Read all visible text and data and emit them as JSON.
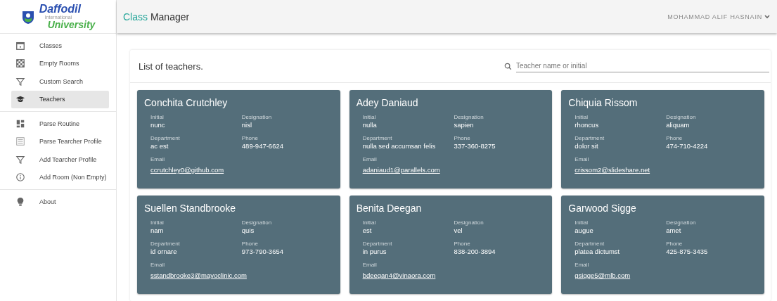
{
  "logo": {
    "name": "Daffodil",
    "subtitle": "International",
    "line2": "University"
  },
  "sidebar": {
    "groups": [
      {
        "items": [
          {
            "label": "Classes",
            "kind": "calendar",
            "selected": false
          },
          {
            "label": "Empty Rooms",
            "kind": "checker",
            "selected": false
          },
          {
            "label": "Custom Search",
            "kind": "filter",
            "selected": false
          },
          {
            "label": "Teachers",
            "kind": "cap",
            "selected": true
          }
        ]
      },
      {
        "items": [
          {
            "label": "Parse Routine",
            "kind": "dashboard",
            "selected": false
          },
          {
            "label": "Parse Tearcher Profile",
            "kind": "list",
            "selected": false
          },
          {
            "label": "Add Tearcher Profile",
            "kind": "filter",
            "selected": false
          },
          {
            "label": "Add Room (Non Empty)",
            "kind": "info",
            "selected": false
          }
        ]
      },
      {
        "items": [
          {
            "label": "About",
            "kind": "bulb",
            "selected": false
          }
        ]
      }
    ]
  },
  "header": {
    "title_accent": "Class",
    "title_rest": "Manager",
    "user": "MOHAMMAD ALIF HASNAIN"
  },
  "panel": {
    "title": "List of teachers.",
    "search": {
      "placeholder": "Teacher name or initial"
    }
  },
  "teachers": [
    {
      "name": "Conchita Crutchley",
      "fields": [
        {
          "label": "Initial",
          "value": "nunc"
        },
        {
          "label": "Designation",
          "value": "nisl"
        },
        {
          "label": "Department",
          "value": "ac est"
        },
        {
          "label": "Phone",
          "value": "489-947-6624"
        }
      ],
      "email_label": "Email",
      "email": "ccrutchley0@github.com"
    },
    {
      "name": "Adey Daniaud",
      "fields": [
        {
          "label": "Initial",
          "value": "nulla"
        },
        {
          "label": "Designation",
          "value": "sapien"
        },
        {
          "label": "Department",
          "value": "nulla sed accumsan felis"
        },
        {
          "label": "Phone",
          "value": "337-360-8275"
        }
      ],
      "email_label": "Email",
      "email": "adaniaud1@parallels.com"
    },
    {
      "name": "Chiquia Rissom",
      "fields": [
        {
          "label": "Initial",
          "value": "rhoncus"
        },
        {
          "label": "Designation",
          "value": "aliquam"
        },
        {
          "label": "Department",
          "value": "dolor sit"
        },
        {
          "label": "Phone",
          "value": "474-710-4224"
        }
      ],
      "email_label": "Email",
      "email": "crissom2@slideshare.net"
    },
    {
      "name": "Suellen Standbrooke",
      "fields": [
        {
          "label": "Initial",
          "value": "nam"
        },
        {
          "label": "Designation",
          "value": "quis"
        },
        {
          "label": "Department",
          "value": "id ornare"
        },
        {
          "label": "Phone",
          "value": "973-790-3654"
        }
      ],
      "email_label": "Email",
      "email": "sstandbrooke3@mayoclinic.com"
    },
    {
      "name": "Benita Deegan",
      "fields": [
        {
          "label": "Initial",
          "value": "est"
        },
        {
          "label": "Designation",
          "value": "vel"
        },
        {
          "label": "Department",
          "value": "in purus"
        },
        {
          "label": "Phone",
          "value": "838-200-3894"
        }
      ],
      "email_label": "Email",
      "email": "bdeegan4@vinaora.com"
    },
    {
      "name": "Garwood Sigge",
      "fields": [
        {
          "label": "Initial",
          "value": "augue"
        },
        {
          "label": "Designation",
          "value": "amet"
        },
        {
          "label": "Department",
          "value": "platea dictumst"
        },
        {
          "label": "Phone",
          "value": "425-875-3435"
        }
      ],
      "email_label": "Email",
      "email": "gsigge5@mlb.com"
    }
  ]
}
